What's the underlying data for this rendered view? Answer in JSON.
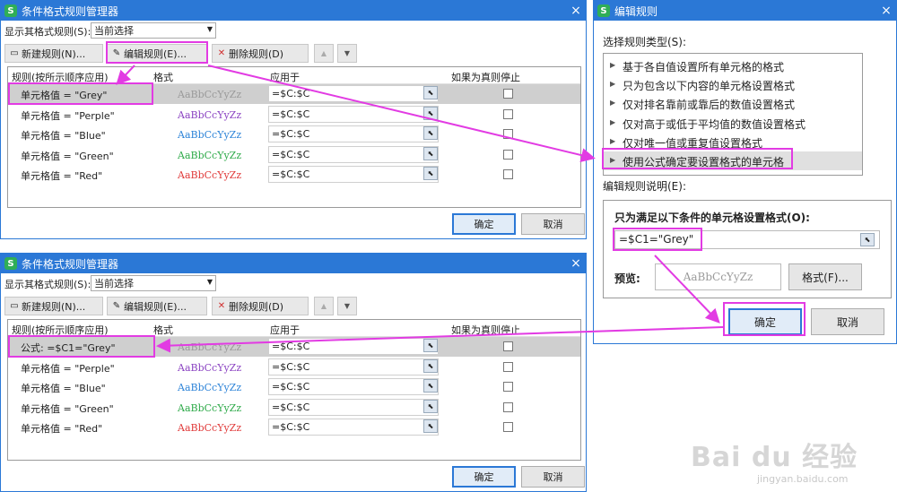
{
  "colors": {
    "accent": "#2b78d6",
    "highlight": "#e23be3"
  },
  "manager_top": {
    "title": "条件格式规则管理器",
    "close_icon": "×",
    "show_label": "显示其格式规则(S):",
    "show_value": "当前选择",
    "toolbar": {
      "new": "新建规则(N)...",
      "edit": "编辑规则(E)...",
      "delete": "删除规则(D)",
      "up": "▲",
      "down": "▼"
    },
    "headers": {
      "rule": "规则(按所示顺序应用)",
      "format": "格式",
      "applies": "应用于",
      "stop": "如果为真则停止"
    },
    "rows": [
      {
        "name": "单元格值 = \"Grey\"",
        "fmt": "AaBbCcYyZz",
        "color": "#9a9a9a",
        "applies": "=$C:$C"
      },
      {
        "name": "单元格值 = \"Perple\"",
        "fmt": "AaBbCcYyZz",
        "color": "#8b44c2",
        "applies": "=$C:$C"
      },
      {
        "name": "单元格值 = \"Blue\"",
        "fmt": "AaBbCcYyZz",
        "color": "#2e84d8",
        "applies": "=$C:$C"
      },
      {
        "name": "单元格值 = \"Green\"",
        "fmt": "AaBbCcYyZz",
        "color": "#2faa4a",
        "applies": "=$C:$C"
      },
      {
        "name": "单元格值 = \"Red\"",
        "fmt": "AaBbCcYyZz",
        "color": "#e03a3a",
        "applies": "=$C:$C"
      }
    ],
    "ok": "确定",
    "cancel": "取消"
  },
  "manager_bottom": {
    "title": "条件格式规则管理器",
    "close_icon": "×",
    "show_label": "显示其格式规则(S):",
    "show_value": "当前选择",
    "toolbar": {
      "new": "新建规则(N)...",
      "edit": "编辑规则(E)...",
      "delete": "删除规则(D)",
      "up": "▲",
      "down": "▼"
    },
    "headers": {
      "rule": "规则(按所示顺序应用)",
      "format": "格式",
      "applies": "应用于",
      "stop": "如果为真则停止"
    },
    "rows": [
      {
        "name": "公式: =$C1=\"Grey\"",
        "fmt": "AaBbCcYyZz",
        "color": "#9a9a9a",
        "applies": "=$C:$C"
      },
      {
        "name": "单元格值 = \"Perple\"",
        "fmt": "AaBbCcYyZz",
        "color": "#8b44c2",
        "applies": "=$C:$C"
      },
      {
        "name": "单元格值 = \"Blue\"",
        "fmt": "AaBbCcYyZz",
        "color": "#2e84d8",
        "applies": "=$C:$C"
      },
      {
        "name": "单元格值 = \"Green\"",
        "fmt": "AaBbCcYyZz",
        "color": "#2faa4a",
        "applies": "=$C:$C"
      },
      {
        "name": "单元格值 = \"Red\"",
        "fmt": "AaBbCcYyZz",
        "color": "#e03a3a",
        "applies": "=$C:$C"
      }
    ],
    "ok": "确定",
    "cancel": "取消"
  },
  "edit_rule": {
    "title": "编辑规则",
    "close_icon": "×",
    "select_type_label": "选择规则类型(S):",
    "types": [
      "基于各自值设置所有单元格的格式",
      "只为包含以下内容的单元格设置格式",
      "仅对排名靠前或靠后的数值设置格式",
      "仅对高于或低于平均值的数值设置格式",
      "仅对唯一值或重复值设置格式",
      "使用公式确定要设置格式的单元格"
    ],
    "desc_label": "编辑规则说明(E):",
    "formula_title": "只为满足以下条件的单元格设置格式(O):",
    "formula_value": "=$C1=\"Grey\"",
    "preview_label": "预览:",
    "preview_text": "AaBbCcYyZz",
    "format_button": "格式(F)...",
    "ok": "确定",
    "cancel": "取消"
  },
  "watermark": {
    "brand": "Bai du 经验",
    "url": "jingyan.baidu.com"
  }
}
